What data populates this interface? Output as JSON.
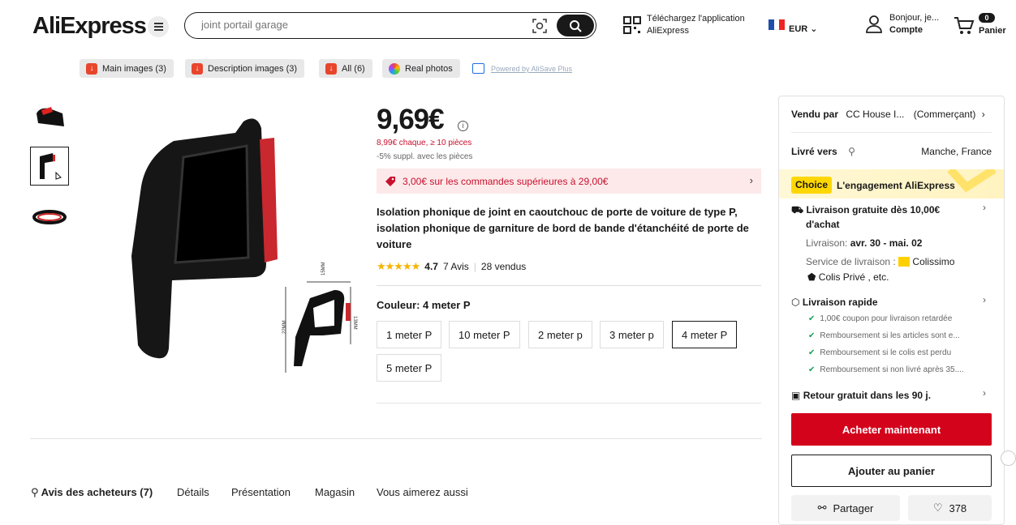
{
  "header": {
    "logo": "AliExpress",
    "search_placeholder": "joint portail garage",
    "app_line1": "Téléchargez l'application",
    "app_line2": "AliExpress",
    "currency": "EUR",
    "greeting": "Bonjour, je...",
    "account": "Compte",
    "cart_count": "0",
    "cart_label": "Panier"
  },
  "toolbar": {
    "main_images": "Main images (3)",
    "description_images": "Description images (3)",
    "all": "All (6)",
    "real_photos": "Real photos",
    "powered": "Powered by AliSave Plus"
  },
  "product": {
    "price": "9,69€",
    "bulk_price": "8,99€ chaque, ≥ 10 pièces",
    "extra_discount": "-5% suppl. avec les pièces",
    "coupon": "3,00€ sur les commandes supérieures à 29,00€",
    "title": "Isolation phonique de joint en caoutchouc de porte de voiture de type P, isolation phonique de garniture de bord de bande d'étanchéité de porte de voiture",
    "rating": "4.7",
    "reviews": "7 Avis",
    "sold": "28 vendus",
    "color_label": "Couleur: 4 meter P",
    "options": [
      "1 meter P",
      "10 meter P",
      "2 meter p",
      "3 meter p",
      "4 meter P",
      "5 meter P"
    ],
    "dim_top": "15MM",
    "dim_left": "22MM",
    "dim_right": "13MM"
  },
  "tabs": {
    "reviews": "Avis des acheteurs (7)",
    "details": "Détails",
    "presentation": "Présentation",
    "store": "Magasin",
    "also_like": "Vous aimerez aussi"
  },
  "panel": {
    "sold_by_label": "Vendu par",
    "seller": "CC House I...",
    "seller_type": "(Commerçant)",
    "ship_label": "Livré vers",
    "ship_to": "Manche, France",
    "choice": "Choice",
    "choice_text": "L'engagement AliExpress",
    "free_ship": "Livraison gratuite dès 10,00€",
    "free_ship2": "d'achat",
    "delivery_label": "Livraison:",
    "delivery_dates": "avr. 30 - mai. 02",
    "service_label": "Service de livraison :",
    "carrier1": "Colissimo",
    "carrier2": "Colis Privé , etc.",
    "fast": "Livraison rapide",
    "check1": "1,00€ coupon pour livraison retardée",
    "check2": "Remboursement si les articles sont e...",
    "check3": "Remboursement si le colis est perdu",
    "check4": "Remboursement si non livré après 35....",
    "returns": "Retour gratuit dans les 90 j.",
    "buy_now": "Acheter maintenant",
    "add_cart": "Ajouter au panier",
    "share": "Partager",
    "wishlist": "378"
  },
  "colors": {
    "brand_red": "#d3031c",
    "star": "#f5b400",
    "choice_yellow": "#ffd700"
  }
}
